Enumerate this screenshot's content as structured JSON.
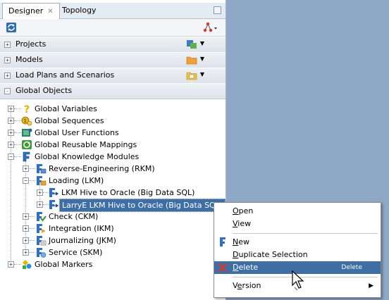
{
  "tabs": [
    {
      "label": "Designer",
      "active": true
    },
    {
      "label": "Topology",
      "active": false
    }
  ],
  "accordions": [
    {
      "label": "Projects",
      "expanded": false,
      "toggle": "+"
    },
    {
      "label": "Models",
      "expanded": false,
      "toggle": "+"
    },
    {
      "label": "Load Plans and Scenarios",
      "expanded": false,
      "toggle": "+"
    },
    {
      "label": "Global Objects",
      "expanded": true,
      "toggle": "-"
    }
  ],
  "tree": {
    "items": [
      {
        "label": "Global Variables",
        "icon": "variable-icon"
      },
      {
        "label": "Global Sequences",
        "icon": "sequence-icon"
      },
      {
        "label": "Global User Functions",
        "icon": "user-function-icon"
      },
      {
        "label": "Global Reusable Mappings",
        "icon": "reusable-mapping-icon"
      },
      {
        "label": "Global Knowledge Modules",
        "icon": "knowledge-module-icon"
      },
      {
        "label": "Reverse-Engineering (RKM)",
        "icon": "rkm-folder-icon"
      },
      {
        "label": "Loading (LKM)",
        "icon": "lkm-folder-icon"
      },
      {
        "label": "LKM Hive to Oracle (Big Data SQL)",
        "icon": "lkm-icon"
      },
      {
        "label": "LarryE LKM Hive to Oracle (Big Data SQL)",
        "icon": "lkm-icon",
        "selected": true
      },
      {
        "label": "Check (CKM)",
        "icon": "ckm-folder-icon"
      },
      {
        "label": "Integration (IKM)",
        "icon": "ikm-folder-icon"
      },
      {
        "label": "Journalizing (JKM)",
        "icon": "jkm-folder-icon"
      },
      {
        "label": "Service (SKM)",
        "icon": "skm-folder-icon"
      },
      {
        "label": "Global Markers",
        "icon": "markers-icon"
      }
    ]
  },
  "context_menu": {
    "items": [
      {
        "label": "Open",
        "accel": "O"
      },
      {
        "label": "View",
        "accel": "V"
      },
      {
        "label": "New",
        "accel": "N"
      },
      {
        "label": "Duplicate Selection",
        "accel": "D"
      },
      {
        "label": "Delete",
        "accel": "D",
        "shortcut": "Delete",
        "highlighted": true
      },
      {
        "label": "Version",
        "accel": "e",
        "submenu": true
      }
    ]
  },
  "colors": {
    "selection": "#3e6ea4",
    "background": "#8fa8c5",
    "delete_icon": "#d23a2a"
  }
}
